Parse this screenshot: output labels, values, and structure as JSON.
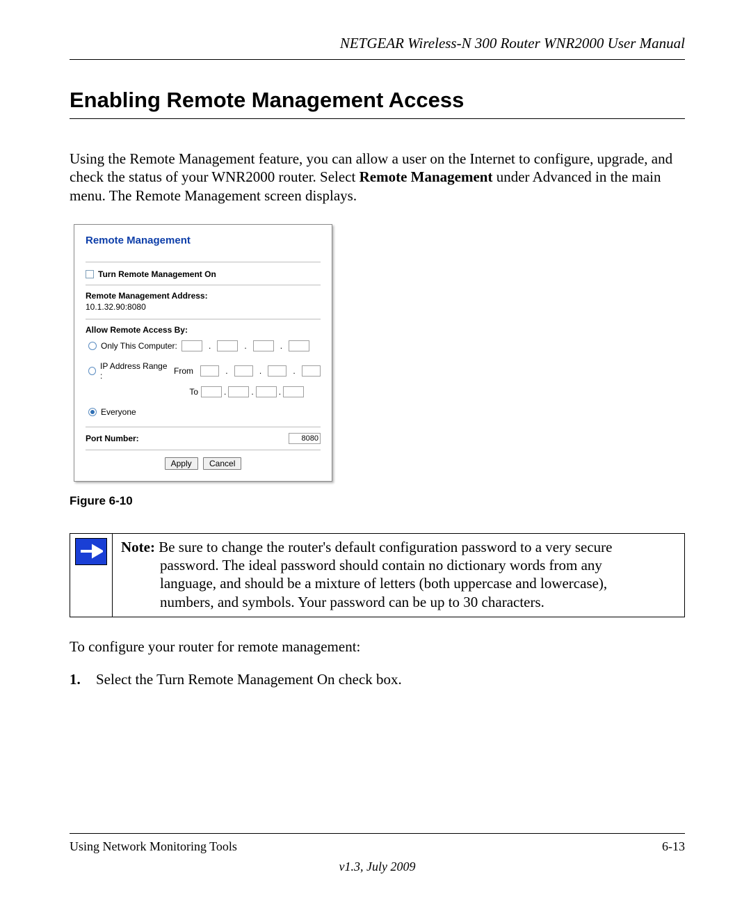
{
  "header": {
    "running_title": "NETGEAR Wireless-N 300 Router WNR2000 User Manual"
  },
  "section": {
    "title": "Enabling Remote Management Access",
    "intro_part1": "Using the Remote Management feature, you can allow a user on the Internet to configure, upgrade, and check the status of your WNR2000 router. Select ",
    "intro_strong": "Remote Management",
    "intro_part2": " under Advanced in the main menu. The Remote Management screen displays."
  },
  "screenshot": {
    "title": "Remote Management",
    "turn_on_label": "Turn Remote Management On",
    "addr_label": "Remote Management Address:",
    "addr_value": "10.1.32.90:8080",
    "allow_label": "Allow Remote Access By:",
    "only_this_label": "Only This Computer:",
    "range_label": "IP Address Range :",
    "from_label": "From",
    "to_label": "To",
    "everyone_label": "Everyone",
    "port_label": "Port Number:",
    "port_value": "8080",
    "apply_label": "Apply",
    "cancel_label": "Cancel"
  },
  "figure_label": "Figure 6-10",
  "note": {
    "prefix": "Note:",
    "line1_rest": " Be sure to change the router's default configuration password to a very secure",
    "line2": "password. The ideal password should contain no dictionary words from any",
    "line3": "language, and should be a mixture of letters (both uppercase and lowercase),",
    "line4": "numbers, and symbols. Your password can be up to 30 characters."
  },
  "configure_intro": "To configure your router for remote management:",
  "step1": {
    "num": "1.",
    "pre": "Select the ",
    "strong": "Turn Remote Management On",
    "post": " check box."
  },
  "footer": {
    "left": "Using Network Monitoring Tools",
    "right": "6-13",
    "caption": "v1.3, July 2009"
  }
}
